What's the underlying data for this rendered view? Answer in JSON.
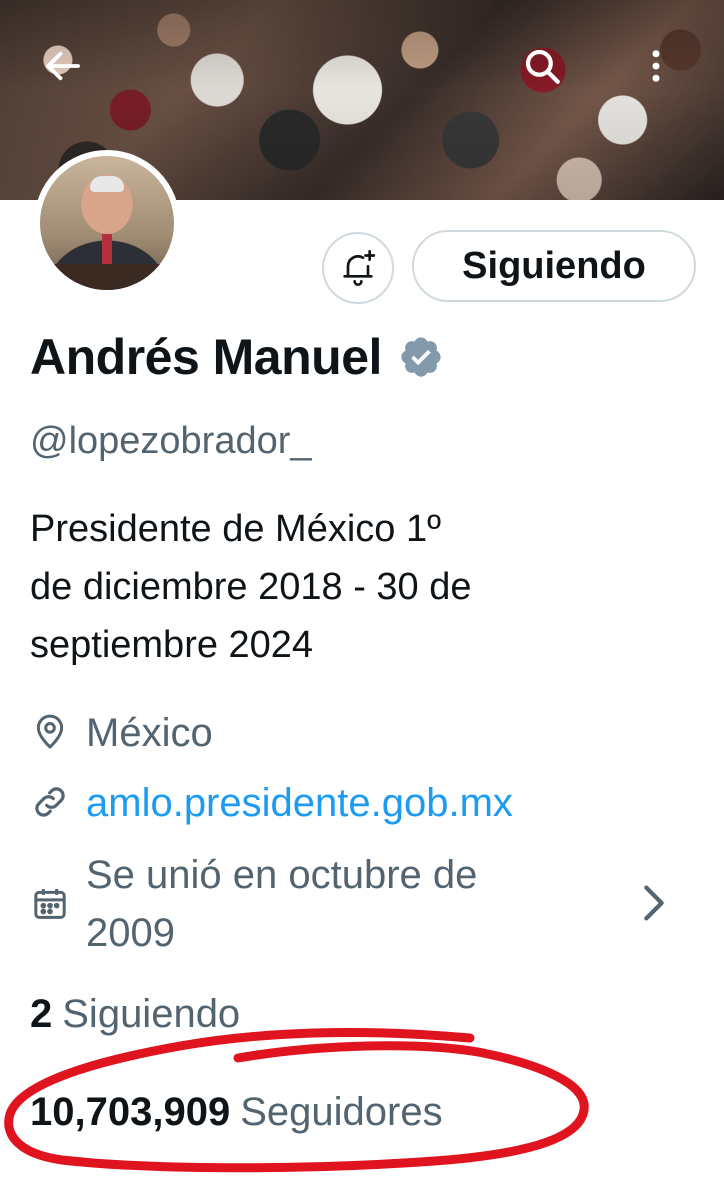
{
  "banner": {
    "description_icon": "crowd-photo"
  },
  "nav": {
    "back_icon": "back-arrow-icon",
    "search_icon": "search-icon",
    "more_icon": "more-vertical-icon"
  },
  "profile": {
    "name": "Andrés Manuel",
    "handle": "@lopezobrador_",
    "bio_lines": [
      "Presidente de México 1º",
      "de diciembre 2018 - 30 de",
      "septiembre 2024"
    ],
    "location": "México",
    "website": "amlo.presidente.gob.mx",
    "joined_lines": [
      "Se unió en octubre de",
      "2009"
    ]
  },
  "actions": {
    "follow_label": "Siguiendo"
  },
  "stats": {
    "following_count": "2",
    "following_label": "Siguiendo",
    "followers_count": "10,703,909",
    "followers_label": "Seguidores"
  },
  "colors": {
    "accent": "#1d9bf0",
    "secondary_text": "#536471",
    "annotation": "#e0141e"
  }
}
